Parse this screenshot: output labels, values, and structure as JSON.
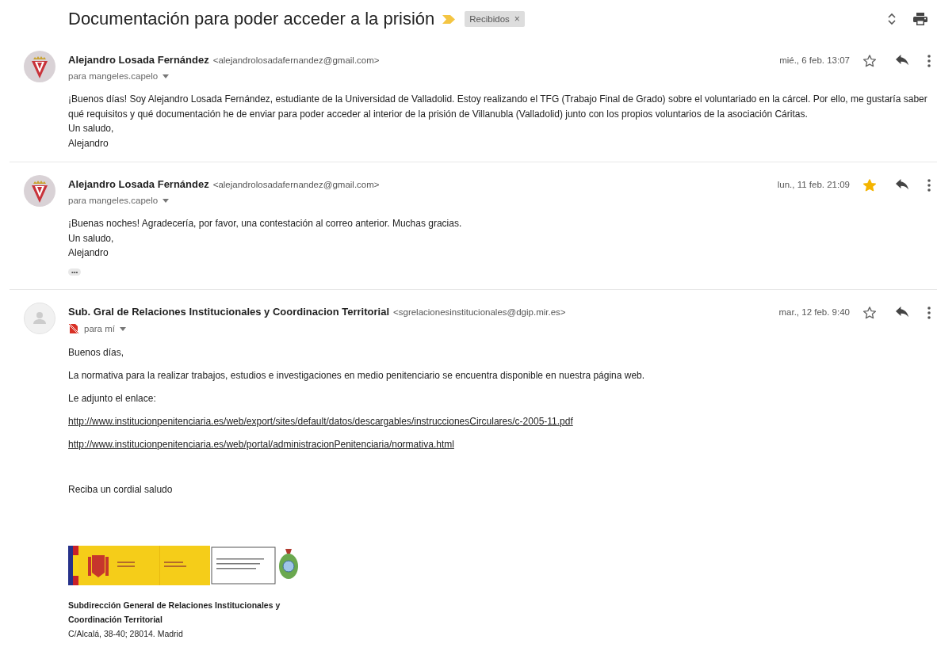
{
  "subject": "Documentación para poder acceder a la prisión",
  "important": true,
  "label": {
    "text": "Recibidos",
    "close": "×"
  },
  "messages": [
    {
      "kind": "crest",
      "sender": "Alejandro Losada Fernández",
      "email": "<alejandrolosadafernandez@gmail.com>",
      "recipient": "para mangeles.capelo",
      "warning": false,
      "date": "mié., 6 feb. 13:07",
      "starred": false,
      "body": [
        {
          "kind": "line",
          "text": "¡Buenos días! Soy Alejandro Losada Fernández, estudiante de la Universidad de Valladolid. Estoy realizando el TFG (Trabajo Final de Grado) sobre el voluntariado en la cárcel. Por ello, me gustaría saber qué requisitos y qué documentación he de enviar para poder acceder al interior de la prisión de Villanubla (Valladolid) junto con los propios voluntarios de la asociación Cáritas."
        },
        {
          "kind": "line",
          "text": "Un saludo,"
        },
        {
          "kind": "line",
          "text": "Alejandro"
        }
      ]
    },
    {
      "kind": "crest",
      "sender": "Alejandro Losada Fernández",
      "email": "<alejandrolosadafernandez@gmail.com>",
      "recipient": "para mangeles.capelo",
      "warning": false,
      "date": "lun., 11 feb. 21:09",
      "starred": true,
      "body": [
        {
          "kind": "line",
          "text": "¡Buenas noches! Agradecería, por favor, una contestación al correo anterior. Muchas gracias."
        },
        {
          "kind": "line",
          "text": "Un saludo,"
        },
        {
          "kind": "line",
          "text": "Alejandro"
        }
      ],
      "trimmed": "•••"
    },
    {
      "kind": "default",
      "sender": "Sub. Gral de Relaciones Institucionales y Coordinacion Territorial",
      "email": "<sgrelacionesinstitucionales@dgip.mir.es>",
      "recipient": "para mí",
      "warning": true,
      "date": "mar., 12 feb. 9:40",
      "starred": false,
      "body": [
        {
          "kind": "paragraph",
          "text": "Buenos días,"
        },
        {
          "kind": "paragraph",
          "text": "La normativa para la realizar trabajos, estudios e investigaciones en medio penitenciario se encuentra disponible en nuestra página web."
        },
        {
          "kind": "paragraph",
          "text": "Le adjunto el enlace:"
        },
        {
          "kind": "link",
          "text": "http://www.institucionpenitenciaria.es/web/export/sites/default/datos/descargables/instruccionesCirculares/c-2005-11.pdf"
        },
        {
          "kind": "link",
          "text": "http://www.institucionpenitenciaria.es/web/portal/administracionPenitenciaria/normativa.html"
        },
        {
          "kind": "closing",
          "text": "Reciba un cordial saludo"
        }
      ],
      "signature": {
        "logo": true,
        "lines": [
          {
            "kind": "bold",
            "text": "Subdirección General de Relaciones Institucionales y"
          },
          {
            "kind": "bold",
            "text": "Coordinación Territorial"
          },
          {
            "kind": "plain",
            "text": "C/Alcalá, 38-40; 28014. Madrid"
          }
        ]
      }
    }
  ]
}
